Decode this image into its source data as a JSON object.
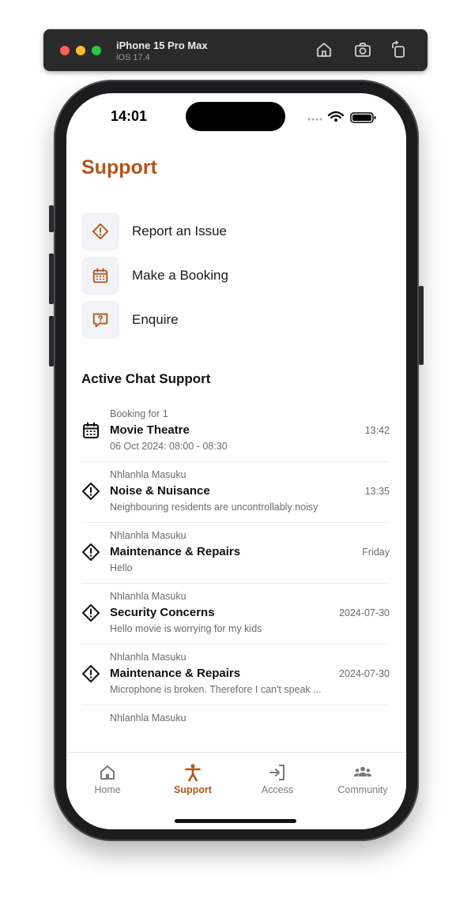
{
  "simulator": {
    "device": "iPhone 15 Pro Max",
    "os": "iOS 17.4",
    "buttons": [
      "home-icon",
      "screenshot-icon",
      "rotate-icon"
    ]
  },
  "status_bar": {
    "time": "14:01"
  },
  "page": {
    "title": "Support"
  },
  "actions": [
    {
      "label": "Report an Issue",
      "icon": "warning-diamond-icon"
    },
    {
      "label": "Make a Booking",
      "icon": "calendar-icon"
    },
    {
      "label": "Enquire",
      "icon": "question-bubble-icon"
    }
  ],
  "active_chat": {
    "heading": "Active Chat Support",
    "items": [
      {
        "sender": "Booking for 1",
        "title": "Movie Theatre",
        "preview": "06 Oct 2024: 08:00 - 08:30",
        "time": "13:42",
        "icon": "calendar-icon"
      },
      {
        "sender": "Nhlanhla Masuku",
        "title": "Noise & Nuisance",
        "preview": "Neighbouring residents are uncontrollably noisy",
        "time": "13:35",
        "icon": "warning-diamond-icon"
      },
      {
        "sender": "Nhlanhla Masuku",
        "title": "Maintenance & Repairs",
        "preview": "Hello",
        "time": "Friday",
        "icon": "warning-diamond-icon"
      },
      {
        "sender": "Nhlanhla Masuku",
        "title": "Security Concerns",
        "preview": "Hello movie is worrying for my kids",
        "time": "2024-07-30",
        "icon": "warning-diamond-icon"
      },
      {
        "sender": "Nhlanhla Masuku",
        "title": "Maintenance & Repairs",
        "preview": "Microphone is broken. Therefore I can't speak ...",
        "time": "2024-07-30",
        "icon": "warning-diamond-icon"
      },
      {
        "sender": "Nhlanhla Masuku",
        "title": "",
        "preview": "",
        "time": "",
        "icon": ""
      }
    ]
  },
  "tabbar": {
    "tabs": [
      {
        "label": "Home",
        "icon": "home-icon",
        "active": false
      },
      {
        "label": "Support",
        "icon": "person-icon",
        "active": true
      },
      {
        "label": "Access",
        "icon": "login-arrow-icon",
        "active": false
      },
      {
        "label": "Community",
        "icon": "group-icon",
        "active": false
      }
    ]
  },
  "colors": {
    "accent": "#b3541e",
    "icon_bg": "#f1f3f6",
    "muted_text": "#6b6b6b"
  }
}
